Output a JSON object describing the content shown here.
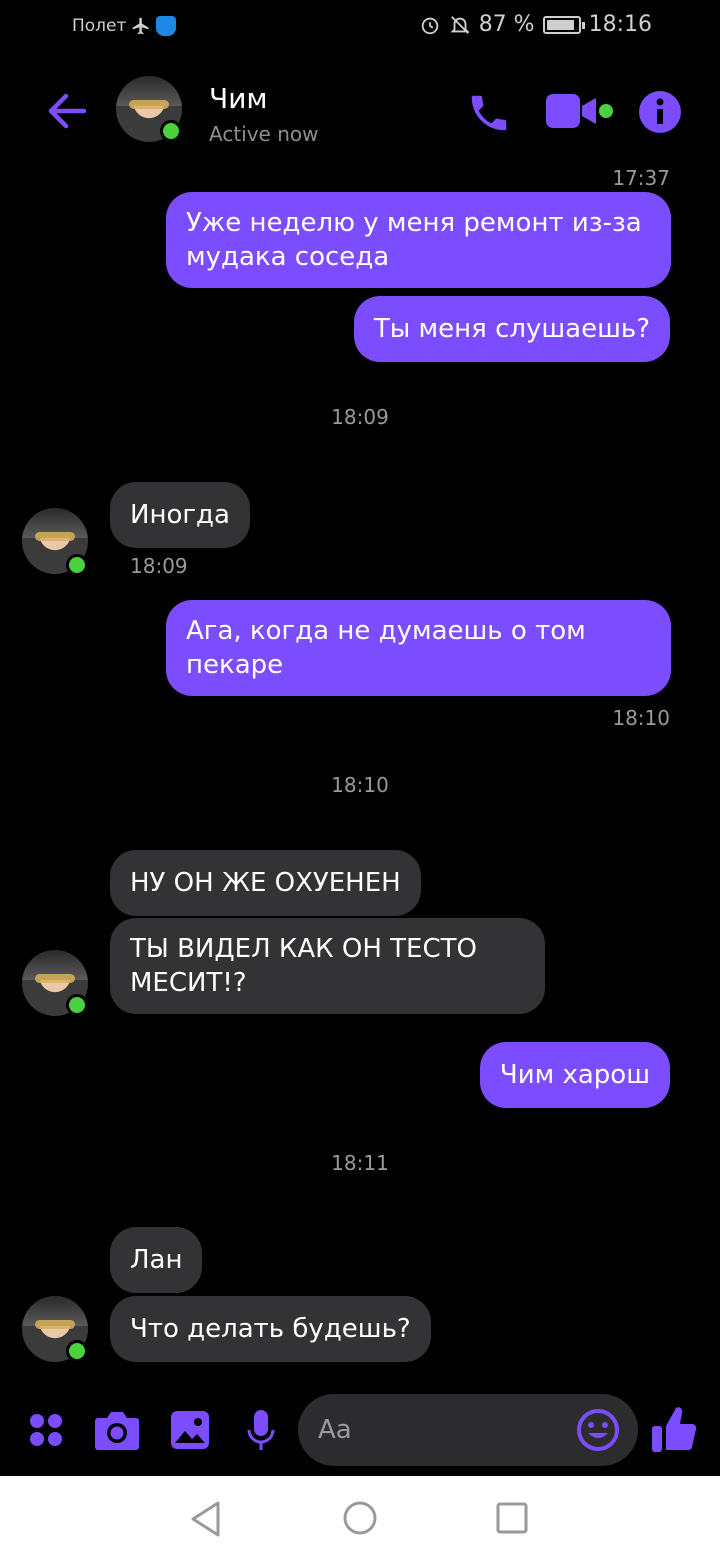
{
  "status_bar": {
    "mode_label": "Полет",
    "battery": "87 %",
    "time": "18:16"
  },
  "header": {
    "contact_name": "Чим",
    "presence": "Active now"
  },
  "messages": [
    {
      "type": "time",
      "text": "17:37"
    },
    {
      "type": "out",
      "text": "Уже неделю у меня ремонт из-за мудака соседа"
    },
    {
      "type": "out",
      "text": "Ты меня слушаешь?"
    },
    {
      "type": "divider",
      "text": "18:09"
    },
    {
      "type": "in",
      "text": "Иногда"
    },
    {
      "type": "time",
      "text": "18:09"
    },
    {
      "type": "out",
      "text": "Ага, когда не думаешь о том пекаре"
    },
    {
      "type": "time",
      "text": "18:10"
    },
    {
      "type": "divider",
      "text": "18:10"
    },
    {
      "type": "in",
      "text": "НУ ОН ЖЕ ОХУЕНЕН"
    },
    {
      "type": "in",
      "text": "ТЫ ВИДЕЛ КАК ОН ТЕСТО МЕСИТ!?"
    },
    {
      "type": "out",
      "text": "Чим харош"
    },
    {
      "type": "divider",
      "text": "18:11"
    },
    {
      "type": "in",
      "text": "Лан"
    },
    {
      "type": "in",
      "text": "Что делать будешь?"
    }
  ],
  "composer": {
    "placeholder": "Aa"
  },
  "colors": {
    "accent": "#7b4dff",
    "incoming_bubble": "#333335",
    "online": "#4cd23f"
  }
}
